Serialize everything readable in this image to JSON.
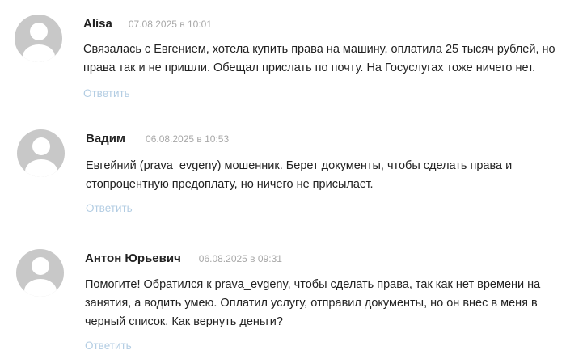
{
  "comments": [
    {
      "author": "Alisa",
      "date": "07.08.2025 в 10:01",
      "lines": [
        "Связалась с Евгением, хотела купить права на машину, оплатила 25 тысяч рублей, но",
        "права так и не пришли. Обещал прислать по почту. На Госуслугах тоже ничего нет."
      ],
      "reply_label": "Ответить"
    },
    {
      "author": "Вадим",
      "date": "06.08.2025 в 10:53",
      "lines": [
        "Евгейний (prava_evgeny) мошенник. Берет документы, чтобы сделать права и",
        "стопроцентную предоплату, но ничего не присылает."
      ],
      "reply_label": "Ответить"
    },
    {
      "author": "Антон Юрьевич",
      "date": "06.08.2025 в 09:31",
      "lines": [
        "Помогите! Обратился к prava_evgeny, чтобы сделать права, так как нет времени на",
        "занятия, а водить умею. Оплатил услугу, отправил документы, но он внес в меня в",
        "черный список. Как вернуть деньги?"
      ],
      "reply_label": "Ответить"
    }
  ]
}
